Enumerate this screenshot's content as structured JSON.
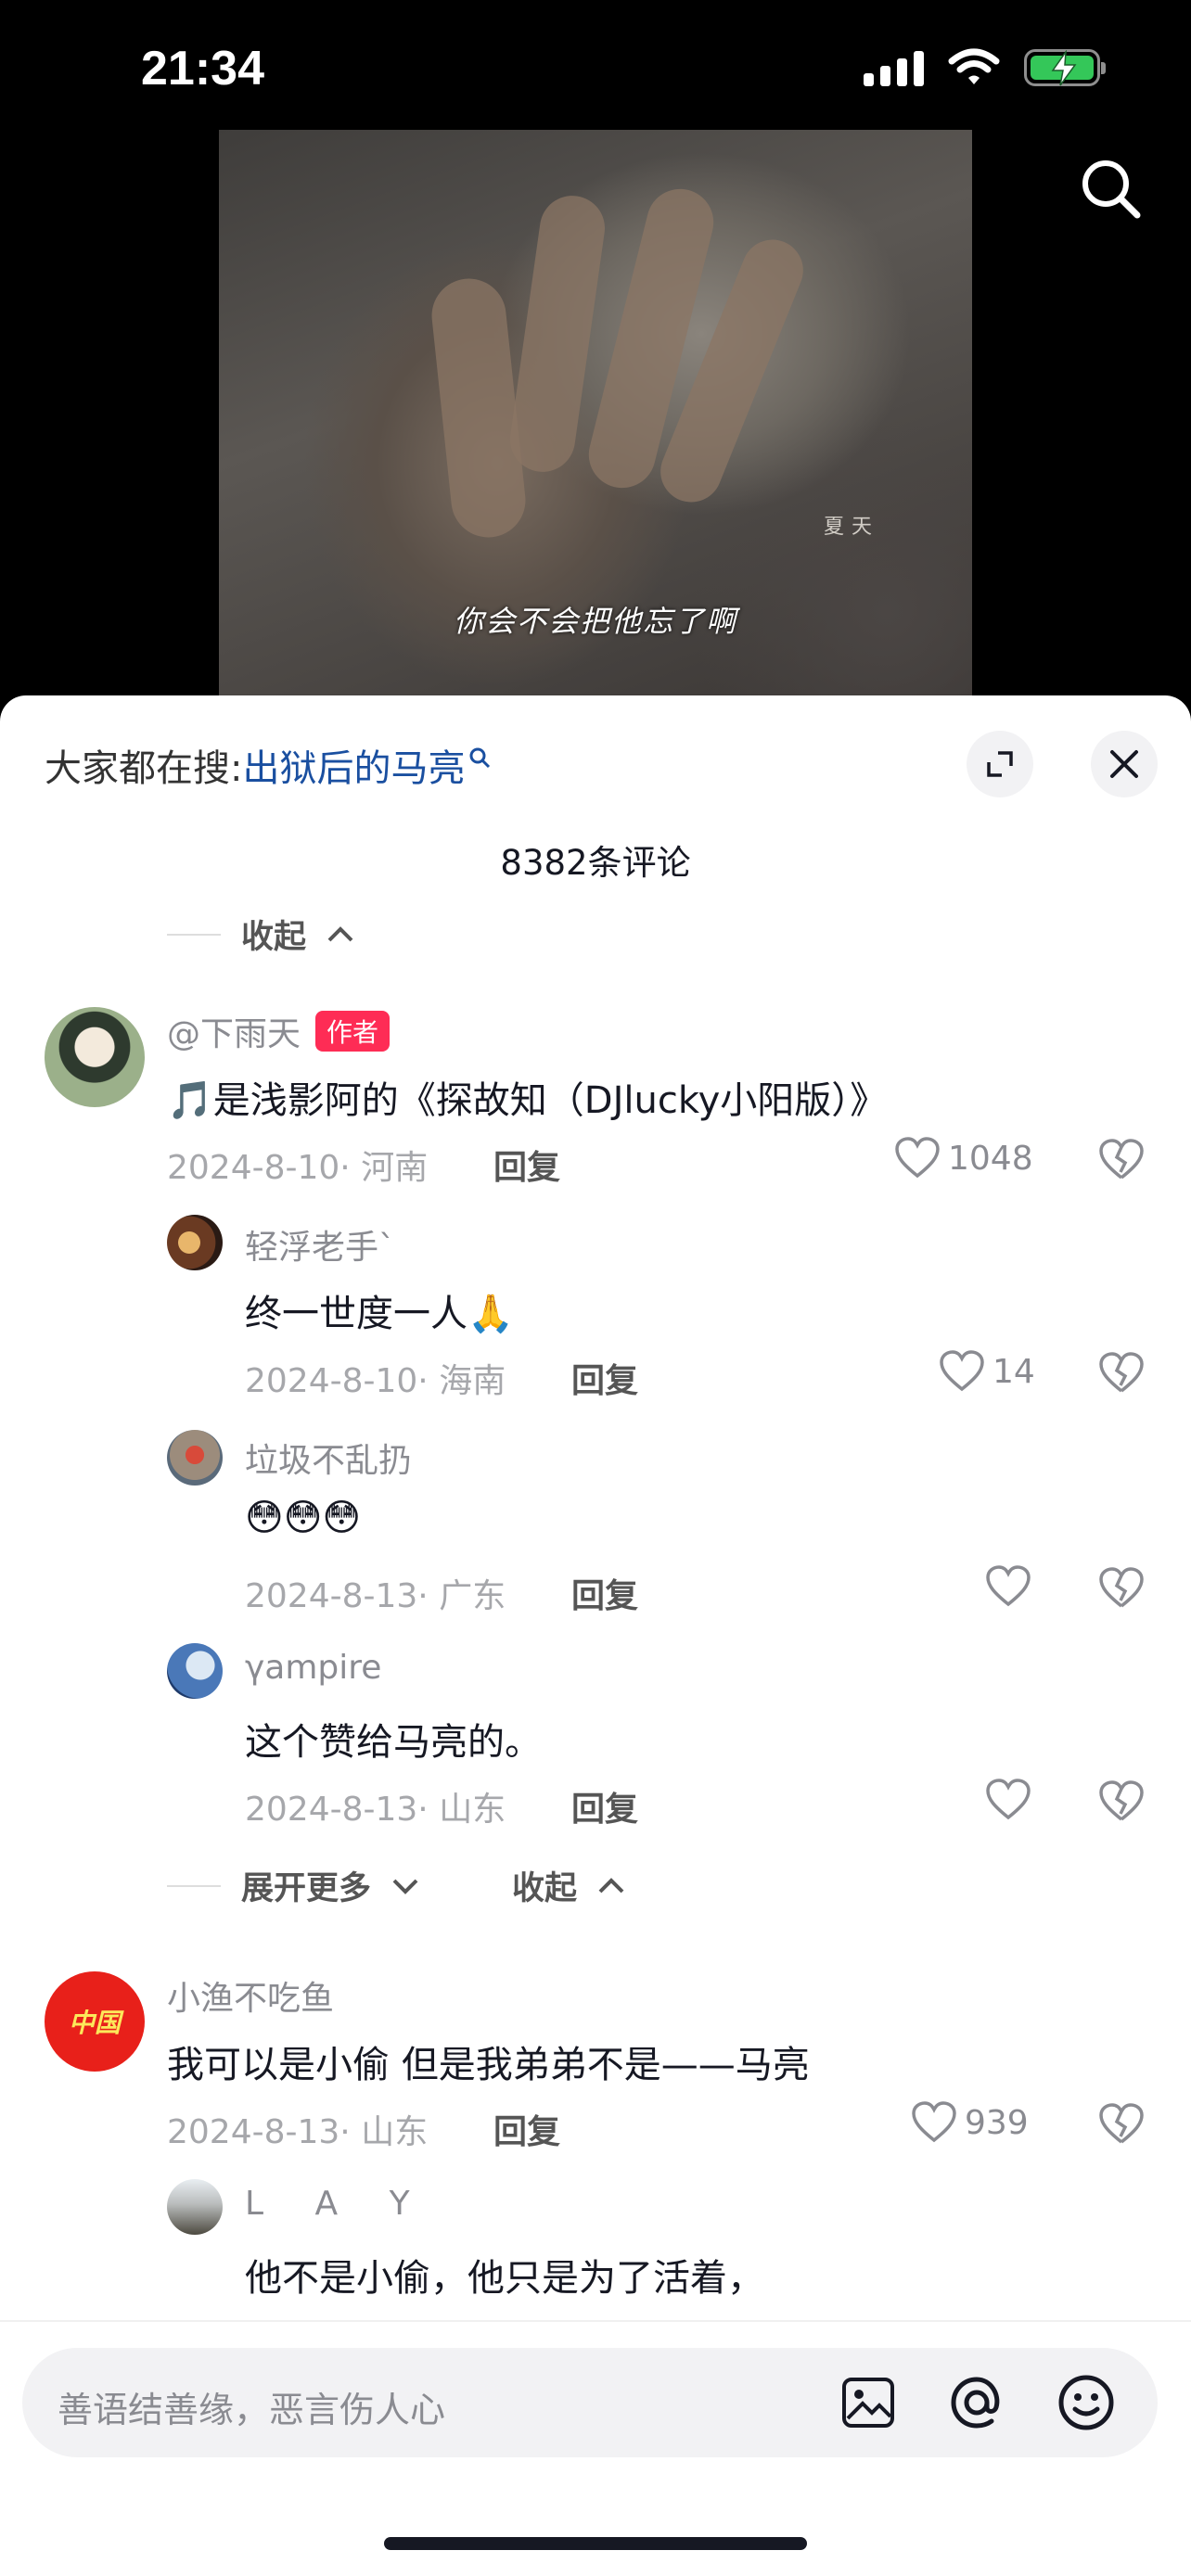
{
  "status": {
    "time": "21:34",
    "battery_color": "#34c759"
  },
  "video": {
    "subtitle": "你会不会把他忘了啊",
    "watermark": "夏天",
    "search_icon": "search-icon"
  },
  "sheet": {
    "search_prompt": "大家都在搜:",
    "search_link": "出狱后的马亮",
    "comment_count": "8382条评论",
    "collapse_label": "收起",
    "expand_more_label": "展开更多",
    "collapse_label_2": "收起",
    "reply_label": "回复",
    "author_tag": "作者"
  },
  "comments": [
    {
      "user": "@下雨天",
      "text": "🎵是浅影阿的《探故知（DJlucky小阳版）》",
      "meta": "2024-8-10· 河南",
      "likes": "1048"
    },
    {
      "user": "轻浮老手`",
      "text": "终一世度一人🙏",
      "meta": "2024-8-10· 海南",
      "likes": "14"
    },
    {
      "user": "垃圾不乱扔",
      "text": "😳😳😳",
      "meta": "2024-8-13· 广东",
      "likes": ""
    },
    {
      "user": "γampire",
      "text": "这个赞给马亮的。",
      "meta": "2024-8-13· 山东",
      "likes": ""
    },
    {
      "user": "小渔不吃鱼",
      "text": "我可以是小偷  但是我弟弟不是——马亮",
      "meta": "2024-8-13· 山东",
      "likes": "939"
    },
    {
      "user": "L A Y",
      "text": "他不是小偷，他只是为了活着，",
      "meta": "",
      "likes": ""
    }
  ],
  "avatar_badge": "中国",
  "input": {
    "placeholder": "善语结善缘，恶言伤人心"
  }
}
